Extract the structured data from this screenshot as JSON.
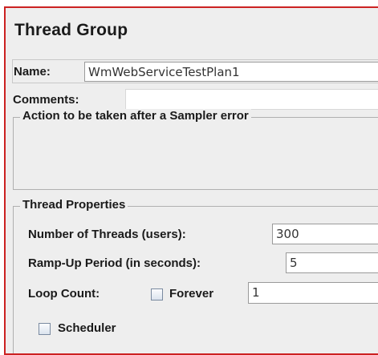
{
  "panel": {
    "title": "Thread Group"
  },
  "name_field": {
    "label": "Name:",
    "value": "WmWebServiceTestPlan1"
  },
  "comments_field": {
    "label": "Comments:",
    "value": ""
  },
  "sampler_error_group": {
    "title": "Action to be taken after a Sampler error"
  },
  "thread_properties": {
    "title": "Thread Properties",
    "num_threads_label": "Number of Threads (users):",
    "num_threads_value": "300",
    "ramp_up_label": "Ramp-Up Period (in seconds):",
    "ramp_up_value": "5",
    "loop_count_label": "Loop Count:",
    "forever_label": "Forever",
    "forever_checked": false,
    "loop_count_value": "1",
    "scheduler_label": "Scheduler",
    "scheduler_checked": false
  },
  "colors": {
    "frame_border": "#cc2222",
    "panel_background": "#eeeeee"
  }
}
